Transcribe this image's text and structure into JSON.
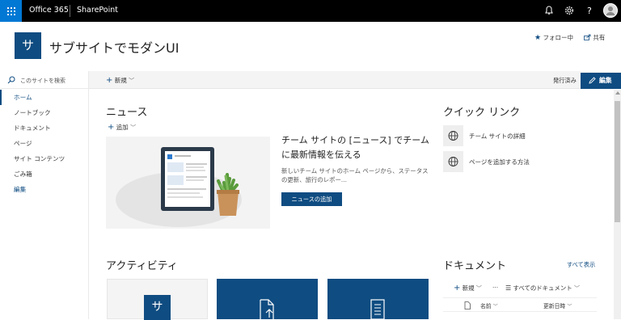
{
  "suitebar": {
    "app_name": "Office 365",
    "product": "SharePoint",
    "icons": [
      "app-launcher-icon",
      "bell-icon",
      "gear-icon",
      "help-icon",
      "user-avatar"
    ]
  },
  "site": {
    "logo_letter": "サ",
    "title": "サブサイトでモダンUI",
    "follow_label": "フォロー中",
    "share_label": "共有"
  },
  "leftnav": {
    "search_placeholder": "このサイトを検索",
    "items": [
      {
        "label": "ホーム",
        "active": true
      },
      {
        "label": "ノートブック"
      },
      {
        "label": "ドキュメント"
      },
      {
        "label": "ページ"
      },
      {
        "label": "サイト コンテンツ"
      },
      {
        "label": "ごみ箱"
      },
      {
        "label": "編集",
        "edit": true
      }
    ]
  },
  "cmdbar": {
    "new_label": "新規",
    "status": "発行済み",
    "edit_label": "編集"
  },
  "news": {
    "title": "ニュース",
    "add_label": "追加",
    "headline": "チーム サイトの [ニュース] でチームに最新情報を伝える",
    "description": "新しいチーム サイトのホーム ページから、ステータスの更新、旅行のレポー...",
    "add_news_button": "ニュースの追加"
  },
  "quicklinks": {
    "title": "クイック リンク",
    "items": [
      {
        "label": "チーム サイトの詳細",
        "icon": "globe-icon"
      },
      {
        "label": "ページを追加する方法",
        "icon": "globe-icon"
      }
    ]
  },
  "activity": {
    "title": "アクティビティ",
    "tiles": [
      {
        "kind": "site-logo",
        "letter": "サ"
      },
      {
        "kind": "document-upload",
        "icon": "file-arrow-icon"
      },
      {
        "kind": "list",
        "icon": "list-doc-icon"
      }
    ]
  },
  "documents": {
    "title": "ドキュメント",
    "see_all": "すべて表示",
    "new_label": "新規",
    "more": "···",
    "view_label": "すべてのドキュメント",
    "col_name": "名前",
    "col_modified": "更新日時"
  },
  "colors": {
    "brand": "#0f4c81",
    "waffle": "#0078d4",
    "suitebar": "#000000"
  }
}
